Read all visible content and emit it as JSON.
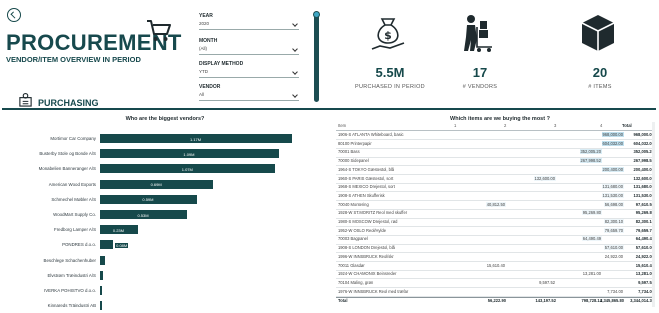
{
  "header": {
    "title": "PROCUREMENT",
    "subtitle": "VENDOR/ITEM OVERVIEW IN PERIOD",
    "section": "PURCHASING"
  },
  "icons": {
    "back": "back-arrow-circle-icon",
    "cart": "shopping-cart-icon",
    "money": "money-bag-hand-icon",
    "vendor": "worker-with-cart-icon",
    "item": "cube-icon",
    "purchasing": "purchasing-icon"
  },
  "slicers": [
    {
      "label": "YEAR",
      "value": "2020"
    },
    {
      "label": "MONTH",
      "value": "(All)"
    },
    {
      "label": "DISPLAY METHOD",
      "value": "YTD"
    },
    {
      "label": "VENDOR",
      "value": "All"
    }
  ],
  "kpis": [
    {
      "value": "5.5M",
      "label": "PURCHASED IN PERIOD"
    },
    {
      "value": "17",
      "label": "# VENDORS"
    },
    {
      "value": "20",
      "label": "# ITEMS"
    }
  ],
  "colors": {
    "primary": "#16494b",
    "accent": "#3fa7c4",
    "highlight": "#cfe8f3"
  },
  "chart_data": {
    "type": "bar",
    "title": "Who are the biggest vendors?",
    "orientation": "horizontal",
    "categories": [
      "Mortimor Car Company",
      "Busterby Stole og Bonde A/S",
      "Monabelien Banneranger A/S",
      "American Wood Exports",
      "Schmechel Møbler A/S",
      "WoodMart Supply Co.",
      "Fredborg Lamper A/S",
      "PONDRES d.o.o.",
      "Beschlege Schachenhuber",
      "Elvstrøm Træindustri A/S",
      "IVERKA POHISTVO d.o.o.",
      "Kinnareds Träindustri AB"
    ],
    "values": [
      1.17,
      1.09,
      1.07,
      0.69,
      0.59,
      0.53,
      0.23,
      0.08,
      0.03,
      0.02,
      0.01,
      0.01
    ],
    "value_labels": [
      "1.17M",
      "1.09M",
      "1.07M",
      "0.69M",
      "0.59M",
      "0.53M",
      "0.23M",
      "0.08M",
      "",
      "",
      "",
      ""
    ],
    "xlim": [
      0,
      1.25
    ]
  },
  "table": {
    "title": "Which items are we buying the most ?",
    "columns": [
      "Item",
      "1",
      "2",
      "3",
      "4",
      "Total"
    ],
    "rows": [
      [
        "1906-S ATLANTA Whiteboard, basic",
        "",
        "",
        "",
        "968,000.00",
        "968,000.00"
      ],
      [
        "80100 Printerpapir",
        "",
        "",
        "",
        "604,032.00",
        "604,032.00"
      ],
      [
        "70001 Bass",
        "",
        "",
        "352,005.20",
        "",
        "352,005.20"
      ],
      [
        "70000 Sidepanel",
        "",
        "",
        "267,998.52",
        "",
        "267,998.52"
      ],
      [
        "1964-S TOKYO Gæstestol, blå",
        "",
        "",
        "",
        "200,400.00",
        "200,400.00"
      ],
      [
        "1960-S PARIS Gæstestol, sort",
        "",
        "132,600.00",
        "",
        "",
        "132,600.00"
      ],
      [
        "1968-S MEXICO Drejestol, sort",
        "",
        "",
        "",
        "131,680.00",
        "131,680.00"
      ],
      [
        "1908-S ATHEN Skufferisk",
        "",
        "",
        "",
        "131,530.00",
        "131,530.00"
      ],
      [
        "70040 Montering",
        "40,812.50",
        "",
        "",
        "56,698.00",
        "97,610.50"
      ],
      [
        "1928-W ST.MORITZ Reol med skuffer",
        "",
        "",
        "95,269.80",
        "",
        "95,269.80"
      ],
      [
        "1980-S MOSCOW Drejestol, rød",
        "",
        "",
        "",
        "82,300.10",
        "82,300.10"
      ],
      [
        "1952-W OSLO Reol/Hylde",
        "",
        "",
        "",
        "79,659.70",
        "79,659.70"
      ],
      [
        "70003 Bagpanel",
        "",
        "",
        "64,490.49",
        "",
        "64,490.49"
      ],
      [
        "1908-S LONDON Drejestol, blå",
        "",
        "",
        "",
        "57,610.00",
        "57,610.00"
      ],
      [
        "1996-W INNSBRUCK Reol/skr",
        "",
        "",
        "",
        "24,922.00",
        "24,922.00"
      ],
      [
        "70011 Glasdør",
        "15,610.40",
        "",
        "",
        "",
        "15,610.40"
      ],
      [
        "1924-W CHAMONIX Beinsreder",
        "",
        "",
        "13,281.00",
        "",
        "13,281.00"
      ],
      [
        "70104 Maling, grøn",
        "",
        "9,597.52",
        "",
        "",
        "9,597.52"
      ],
      [
        "1976-W INNSBRUCK Reol med træfar",
        "",
        "",
        "",
        "7,734.00",
        "7,734.00"
      ]
    ],
    "total": [
      "Total",
      "56,222.90",
      "143,197.52",
      "798,728.14",
      "2,345,865.80",
      "3,344,014.36"
    ]
  }
}
